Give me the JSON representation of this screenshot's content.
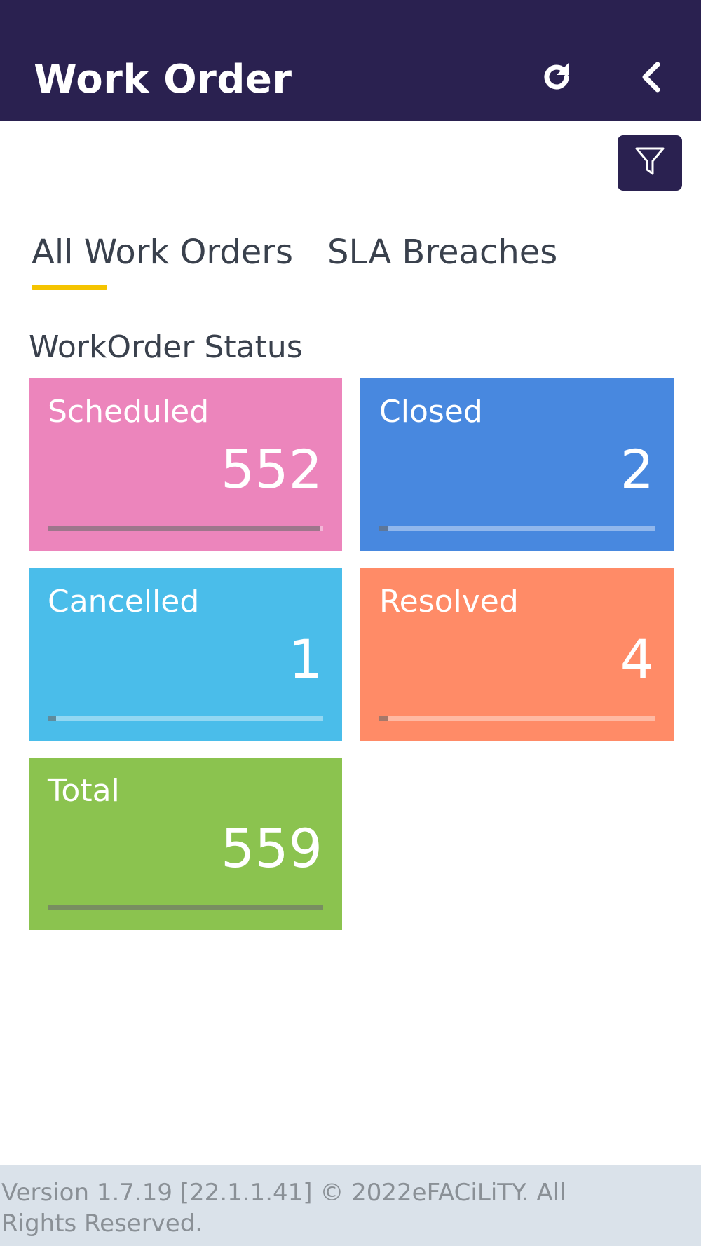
{
  "header": {
    "title": "Work Order",
    "refresh_icon": "refresh-icon",
    "back_icon": "chevron-left-icon",
    "background": "#2a2150"
  },
  "filter": {
    "icon": "filter-icon"
  },
  "tabs": [
    {
      "label": "All Work Orders",
      "active": true
    },
    {
      "label": "SLA Breaches",
      "active": false
    }
  ],
  "tab_indicator_color": "#f5c400",
  "section_title": "WorkOrder Status",
  "cards": [
    {
      "label": "Scheduled",
      "value": "552",
      "progress": 0.99,
      "color": "#ec85bc"
    },
    {
      "label": "Closed",
      "value": "2",
      "progress": 0.0,
      "color": "#4888df"
    },
    {
      "label": "Cancelled",
      "value": "1",
      "progress": 0.0,
      "color": "#4abdea"
    },
    {
      "label": "Resolved",
      "value": "4",
      "progress": 0.01,
      "color": "#ff8b67"
    },
    {
      "label": "Total",
      "value": "559",
      "progress": 1.0,
      "color": "#8bc34f"
    }
  ],
  "footer": {
    "text": "Version 1.7.19 [22.1.1.41] © 2022eFACiLiTY. All Rights Reserved."
  }
}
